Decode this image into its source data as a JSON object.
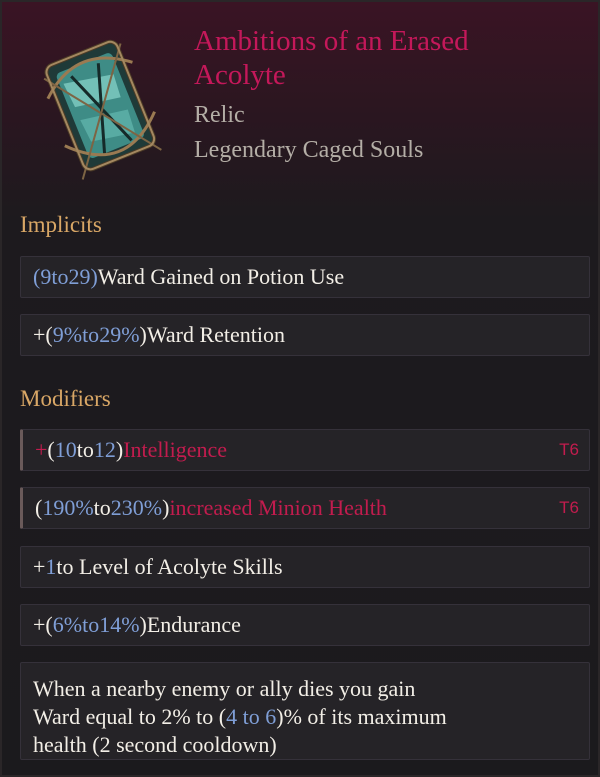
{
  "item": {
    "name_line1": "Ambitions of an Erased",
    "name_line2": "Acolyte",
    "slot": "Relic",
    "rarity_type": "Legendary Caged Souls",
    "icon": "caged-souls-relic-icon"
  },
  "implicits": {
    "label": "Implicits",
    "rows": [
      {
        "prefix": "(",
        "min": "9",
        "to": " to ",
        "max": "29",
        "suffix_close": ")",
        "text": " Ward Gained on Potion Use"
      },
      {
        "prefix": "+(",
        "min": "9%",
        "to": " to ",
        "max": "29%",
        "suffix_close": ")",
        "text": " Ward Retention"
      }
    ]
  },
  "modifiers": {
    "label": "Modifiers",
    "rows": [
      {
        "lead": "+",
        "prefix": "(",
        "min": "10",
        "to": " to ",
        "max": "12",
        "close": ")",
        "text": " Intelligence",
        "tier": "T6"
      },
      {
        "lead": "",
        "prefix": "(",
        "min": "190%",
        "to": " to ",
        "max": "230%",
        "close": ")",
        "text": " increased Minion Health",
        "tier": "T6"
      },
      {
        "lead": "+",
        "value": "1",
        "text": " to Level of Acolyte Skills"
      },
      {
        "lead": "+",
        "prefix": "(",
        "min": "6%",
        "to": " to ",
        "max": "14%",
        "close": ")",
        "text": " Endurance"
      }
    ],
    "unique_mod": {
      "line1": "When a nearby enemy or ally dies you gain",
      "line2_pre": "Ward equal to 2% to (",
      "line2_min": "4",
      "line2_to": " to ",
      "line2_max": "6",
      "line2_post": ")% of its maximum",
      "line3": "health (2 second cooldown)"
    }
  },
  "colors": {
    "title": "#c4185a",
    "section": "#d9a766",
    "range": "#7f9ed6",
    "affix_red": "#c21c4e"
  }
}
